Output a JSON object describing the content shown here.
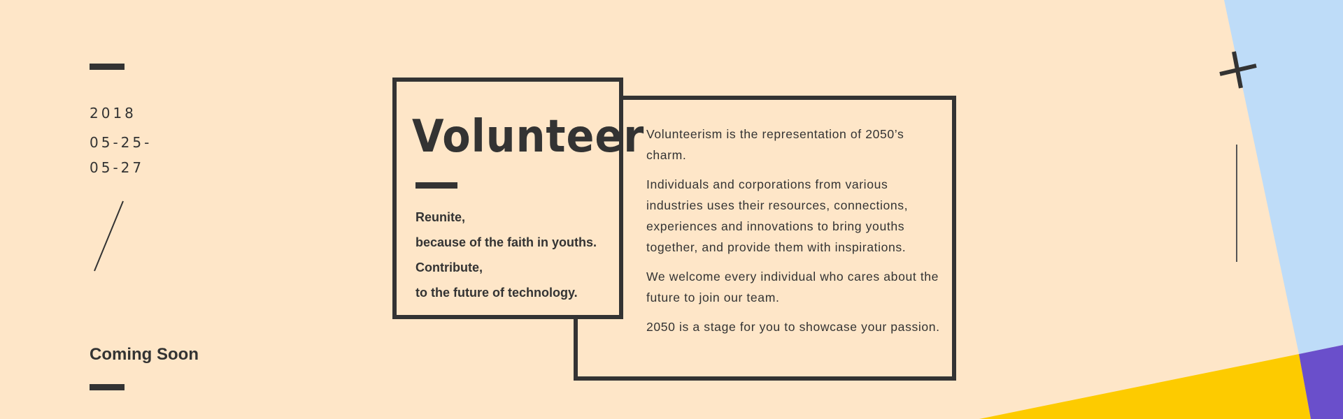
{
  "date": {
    "year": "2018",
    "start": "05-25-",
    "end": "05-27"
  },
  "status": {
    "coming_soon": "Coming Soon"
  },
  "card": {
    "title": "Volunteer",
    "tagline": [
      "Reunite,",
      "because of the faith in youths.",
      "Contribute,",
      "to the future of technology."
    ]
  },
  "description": {
    "paragraphs": [
      "Volunteerism is the representation of 2050’s charm.",
      "Individuals and corporations from various industries uses their resources, connections, experiences and innovations to bring youths together, and provide them with inspirations.",
      "We welcome every individual who cares about the future to join our team.",
      "2050 is a stage for you to showcase your passion."
    ]
  },
  "decor": {
    "plus_icon": "plus-icon",
    "slash_icon": "slash-icon"
  },
  "colors": {
    "background": "#FEE6C8",
    "ink": "#333333",
    "light_blue": "#BEDCF8",
    "yellow": "#FDCB00",
    "purple": "#6A4FCB"
  }
}
